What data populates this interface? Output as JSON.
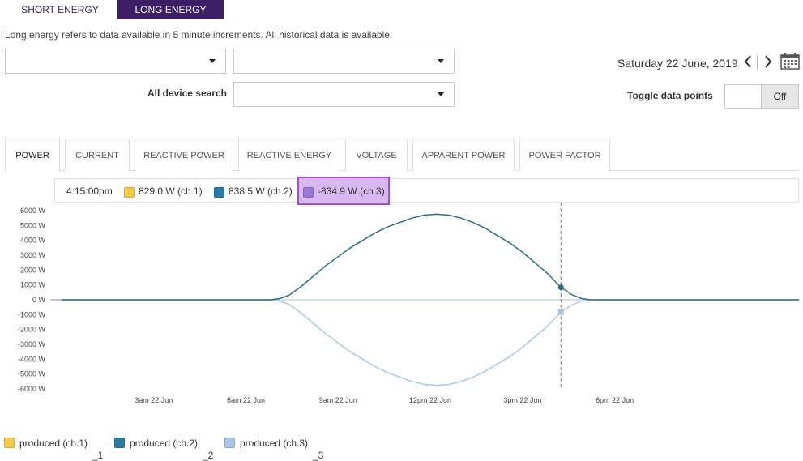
{
  "energy_tabs": {
    "short": "SHORT ENERGY",
    "long": "LONG ENERGY"
  },
  "description": "Long energy refers to data available in 5 minute increments. All historical data is available.",
  "search": {
    "all_device_label": "All device search"
  },
  "date": {
    "display": "Saturday 22 June, 2019"
  },
  "toggle": {
    "label": "Toggle data points",
    "state": "Off"
  },
  "measure_tabs": [
    {
      "label": "POWER",
      "active": true
    },
    {
      "label": "CURRENT"
    },
    {
      "label": "REACTIVE POWER"
    },
    {
      "label": "REACTIVE ENERGY"
    },
    {
      "label": "VOLTAGE"
    },
    {
      "label": "APPARENT POWER"
    },
    {
      "label": "POWER FACTOR"
    }
  ],
  "hover_legend": {
    "time": "4:15:00pm",
    "ch1": "829.0 W (ch.1)",
    "ch2": "838.5 W (ch.2)",
    "ch3": "-834.9 W (ch.3)"
  },
  "colors": {
    "ch1": "#f7c843",
    "ch2": "#2a7ca8",
    "ch3": "#aac6e6",
    "ch3_hover": "#9a7ad8",
    "line_ch2": "#2f6e7e",
    "accent": "#3d1f66"
  },
  "chart_data": {
    "type": "line",
    "ylim": [
      -6000,
      6000
    ],
    "yticks": [
      "6000 W",
      "5000 W",
      "4000 W",
      "3000 W",
      "2000 W",
      "1000 W",
      "0 W",
      "-1000 W",
      "-2000 W",
      "-3000 W",
      "-4000 W",
      "-5000 W",
      "-6000 W"
    ],
    "ytick_values": [
      6000,
      5000,
      4000,
      3000,
      2000,
      1000,
      0,
      -1000,
      -2000,
      -3000,
      -4000,
      -5000,
      -6000
    ],
    "xlim": [
      0,
      24
    ],
    "xticks": [
      {
        "v": 3,
        "label": "3am 22 Jun"
      },
      {
        "v": 6,
        "label": "6am 22 Jun"
      },
      {
        "v": 9,
        "label": "9am 22 Jun"
      },
      {
        "v": 12,
        "label": "12pm 22 Jun"
      },
      {
        "v": 15,
        "label": "3pm 22 Jun"
      },
      {
        "v": 18,
        "label": "6pm 22 Jun"
      }
    ],
    "hover_x": 16.25,
    "series": [
      {
        "name": "produced (ch.1)",
        "x": [
          0,
          24
        ],
        "y": [
          0,
          0
        ]
      },
      {
        "name": "produced (ch.2)",
        "x": [
          0,
          6.8,
          7.1,
          7.4,
          7.8,
          8.2,
          8.6,
          9,
          9.4,
          9.8,
          10.2,
          10.6,
          11,
          11.4,
          11.8,
          12.2,
          12.6,
          13,
          13.4,
          13.8,
          14.2,
          14.6,
          15,
          15.4,
          15.8,
          16.25,
          16.6,
          16.9,
          17.2,
          24
        ],
        "y": [
          0,
          0,
          80,
          300,
          900,
          1600,
          2300,
          2900,
          3500,
          4000,
          4500,
          4900,
          5200,
          5500,
          5700,
          5760,
          5700,
          5500,
          5200,
          4800,
          4300,
          3800,
          3200,
          2500,
          1800,
          838.5,
          350,
          100,
          0,
          0
        ]
      },
      {
        "name": "produced (ch.3)",
        "x": [
          0,
          6.8,
          7.1,
          7.4,
          7.8,
          8.2,
          8.6,
          9,
          9.4,
          9.8,
          10.2,
          10.6,
          11,
          11.4,
          11.8,
          12.2,
          12.6,
          13,
          13.4,
          13.8,
          14.2,
          14.6,
          15,
          15.4,
          15.8,
          16.25,
          16.6,
          16.9,
          17.2,
          24
        ],
        "y": [
          0,
          0,
          -80,
          -300,
          -900,
          -1600,
          -2300,
          -2900,
          -3500,
          -4000,
          -4500,
          -4900,
          -5200,
          -5500,
          -5700,
          -5760,
          -5700,
          -5500,
          -5200,
          -4800,
          -4300,
          -3800,
          -3200,
          -2500,
          -1800,
          -834.9,
          -350,
          -100,
          0,
          0
        ]
      }
    ]
  },
  "bottom_legend": [
    {
      "label": "produced (ch.1)",
      "sub": "_1"
    },
    {
      "label": "produced (ch.2)",
      "sub": "_2"
    },
    {
      "label": "produced (ch.3)",
      "sub": "_3"
    }
  ]
}
